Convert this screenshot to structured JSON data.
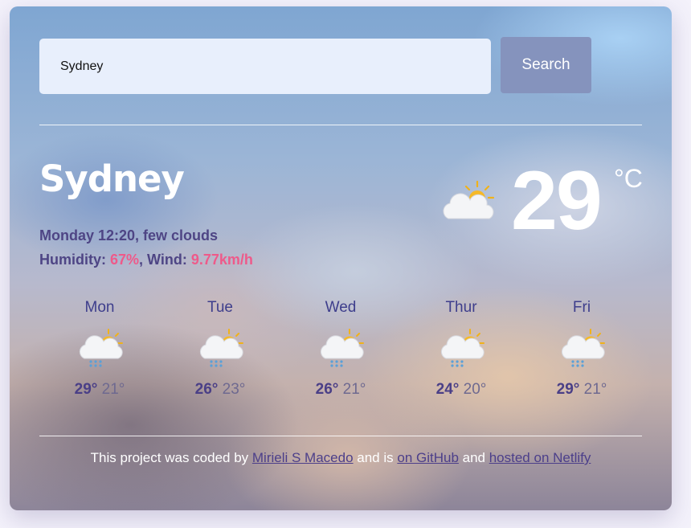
{
  "search": {
    "value": "Sydney",
    "button_label": "Search"
  },
  "current": {
    "city": "Sydney",
    "datetime_desc": "Monday 12:20, few clouds",
    "humidity_label": "Humidity: ",
    "humidity": "67%",
    "wind_label": "Wind: ",
    "wind": "9.77km/h",
    "temperature": "29",
    "unit": "°C",
    "icon": "sun-behind-cloud-icon"
  },
  "forecast": [
    {
      "day": "Mon",
      "max": "29°",
      "min": "21°",
      "icon": "rain-cloud-sun-icon"
    },
    {
      "day": "Tue",
      "max": "26°",
      "min": "23°",
      "icon": "rain-cloud-sun-icon"
    },
    {
      "day": "Wed",
      "max": "26°",
      "min": "21°",
      "icon": "rain-cloud-sun-icon"
    },
    {
      "day": "Thur",
      "max": "24°",
      "min": "20°",
      "icon": "rain-cloud-sun-icon"
    },
    {
      "day": "Fri",
      "max": "29°",
      "min": "21°",
      "icon": "rain-cloud-sun-icon"
    }
  ],
  "footer": {
    "prefix": "This project was coded by ",
    "author": "Mirieli S Macedo",
    "mid": " and is ",
    "github": "on GitHub",
    "and": " and ",
    "netlify": "hosted on Netlify"
  },
  "colors": {
    "accent": "#ee5a8a",
    "button": "#8593bd",
    "text": "#4e4585"
  }
}
